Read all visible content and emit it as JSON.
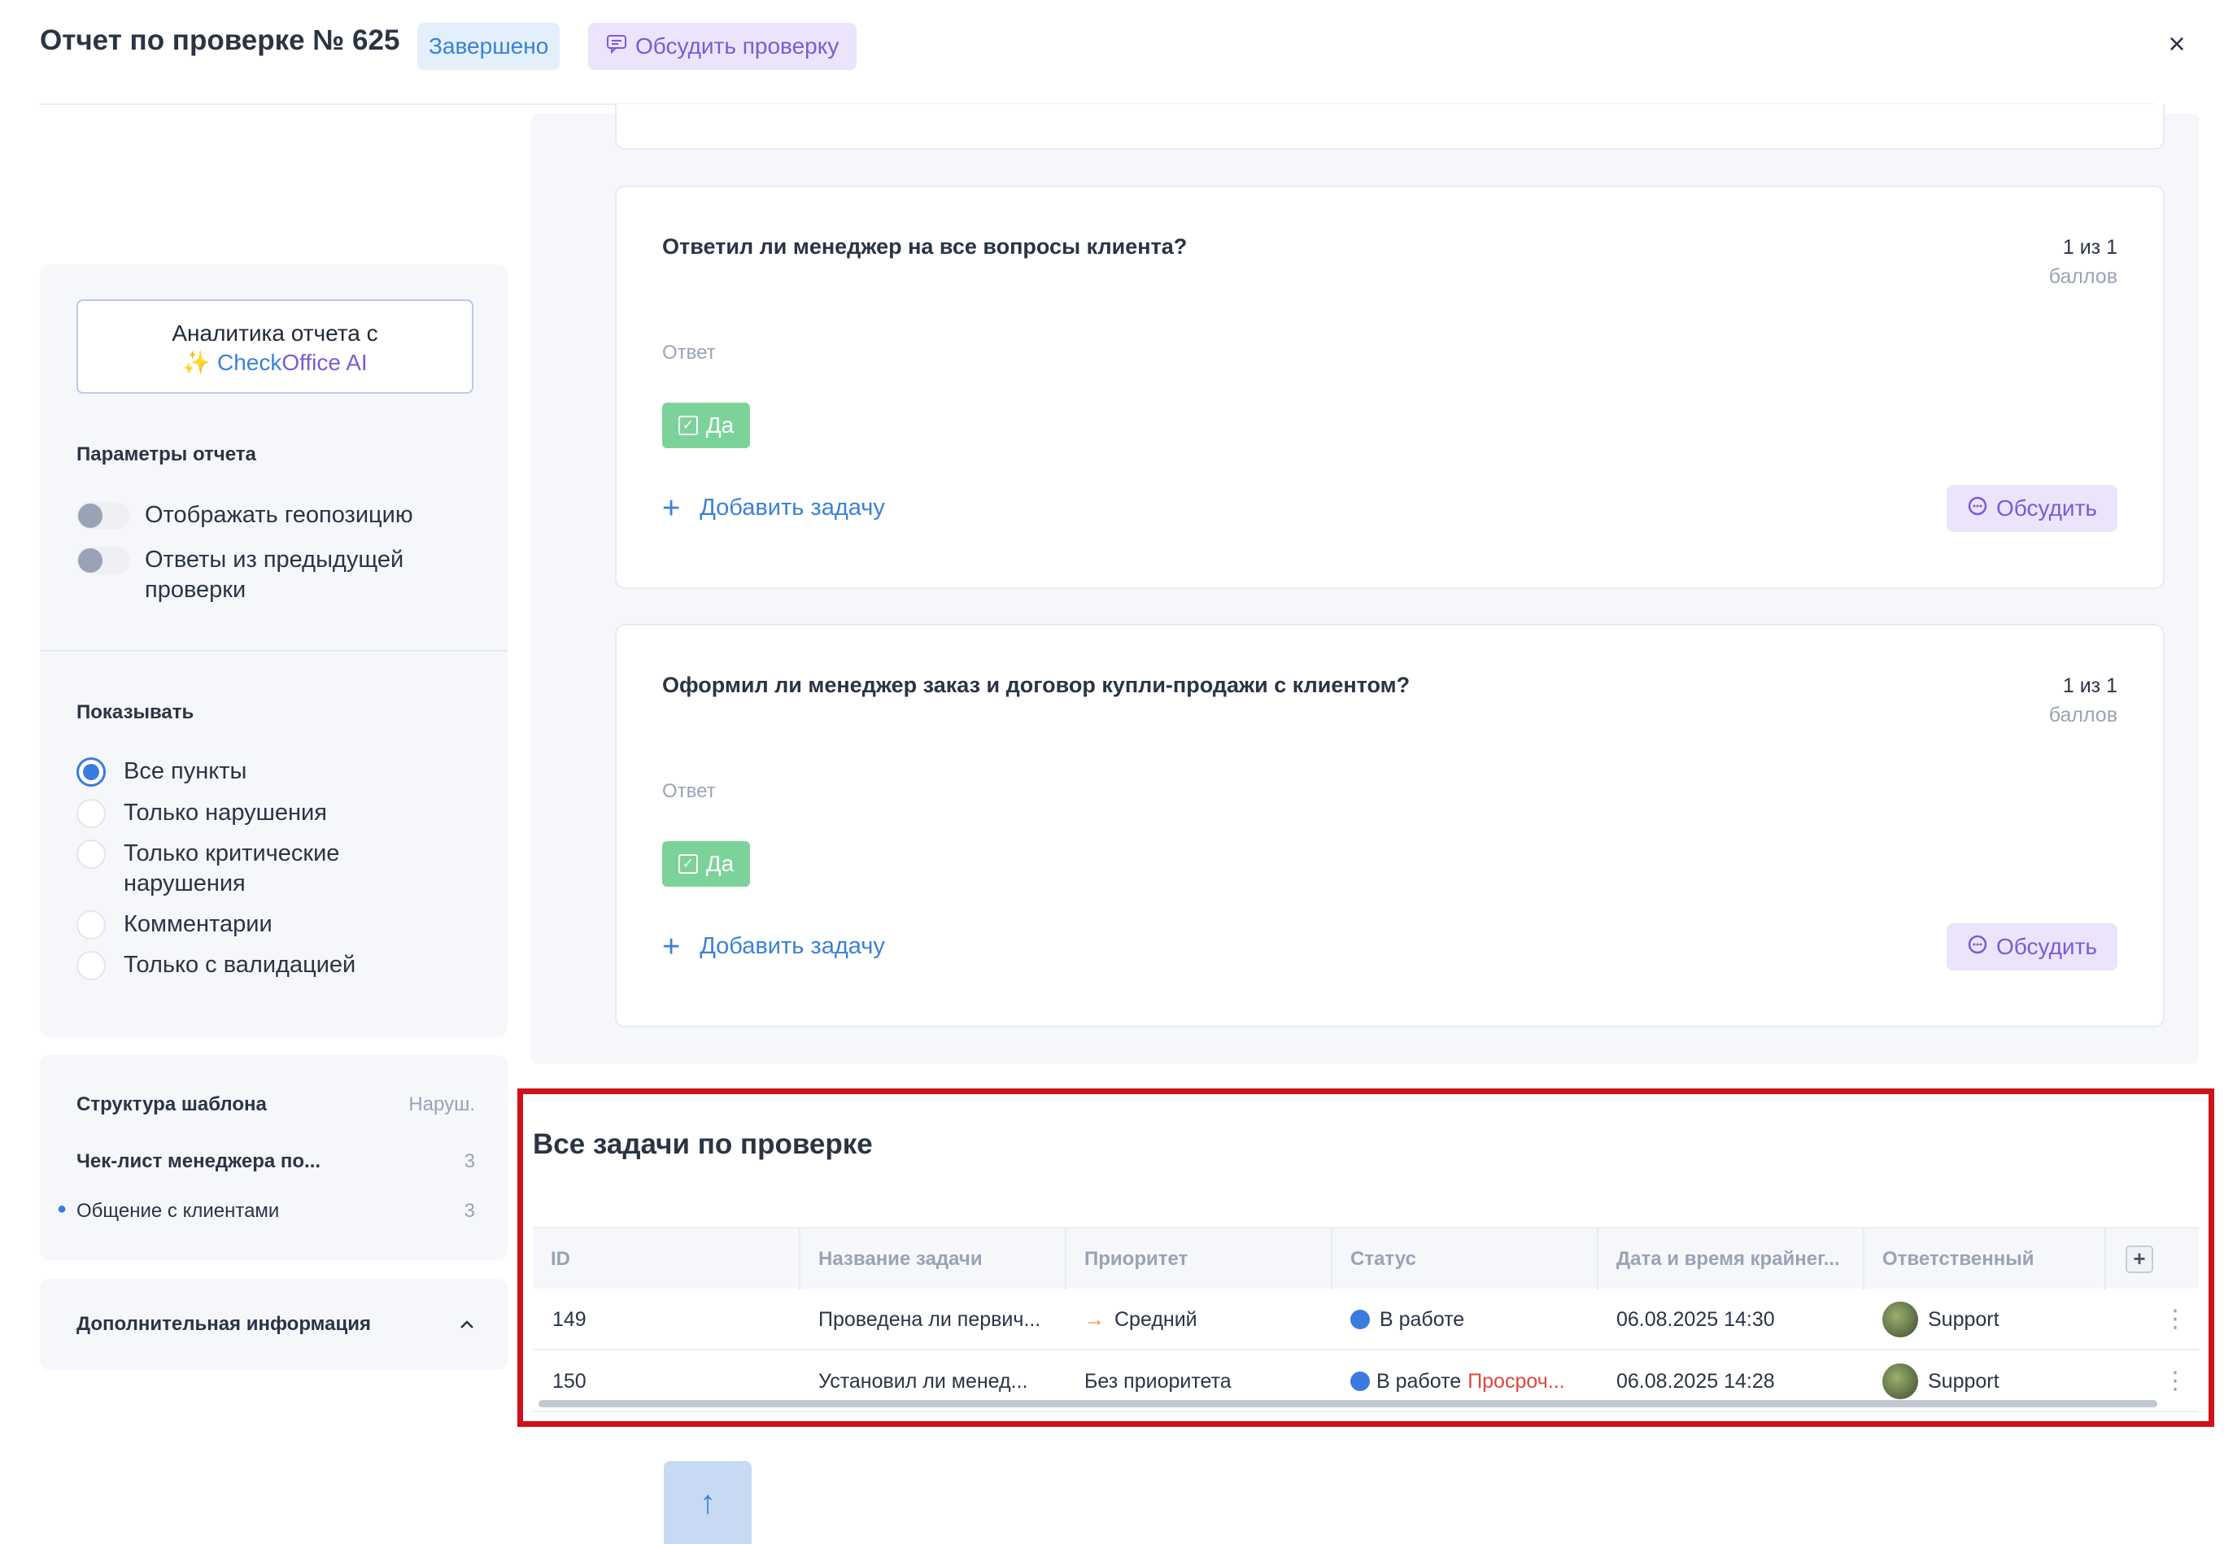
{
  "header": {
    "title": "Отчет по проверке № 625",
    "status_badge": "Завершено",
    "discuss_button": "Обсудить проверку",
    "close": "×"
  },
  "sidebar": {
    "ai_button_line1": "Аналитика отчета с",
    "ai_button_sparkle": "✨",
    "ai_button_brand1": "Check",
    "ai_button_brand2": "Office AI",
    "params_title": "Параметры отчета",
    "toggles": [
      {
        "label": "Отображать геопозицию",
        "on": false
      },
      {
        "label": "Ответы из предыдущей проверки",
        "on": false
      }
    ],
    "show_title": "Показывать",
    "radios": [
      {
        "label": "Все пункты",
        "checked": true
      },
      {
        "label": "Только нарушения",
        "checked": false
      },
      {
        "label": "Только критические нарушения",
        "checked": false
      },
      {
        "label": "Комментарии",
        "checked": false
      },
      {
        "label": "Только с валидацией",
        "checked": false
      }
    ],
    "structure_title": "Структура шаблона",
    "structure_col": "Наруш.",
    "structure_items": [
      {
        "label": "Чек-лист менеджера по...",
        "count": "3"
      },
      {
        "label": "Общение с клиентами",
        "count": "3"
      }
    ],
    "extra_title": "Дополнительная информация"
  },
  "questions": [
    {
      "title": "Ответил ли менеджер на все вопросы клиента?",
      "score": "1 из 1",
      "score_unit": "баллов",
      "answer_label": "Ответ",
      "answer": "Да",
      "add_task": "Добавить задачу",
      "discuss": "Обсудить"
    },
    {
      "title": "Оформил ли менеджер заказ и договор купли-продажи с клиентом?",
      "score": "1 из 1",
      "score_unit": "баллов",
      "answer_label": "Ответ",
      "answer": "Да",
      "add_task": "Добавить задачу",
      "discuss": "Обсудить"
    }
  ],
  "tasks": {
    "title": "Все задачи по проверке",
    "columns": [
      "ID",
      "Название задачи",
      "Приоритет",
      "Статус",
      "Дата и время крайнег...",
      "Ответственный"
    ],
    "add_column": "+",
    "rows": [
      {
        "id": "149",
        "name": "Проведена ли первич...",
        "priority": "Средний",
        "priority_icon": "→",
        "status": "В работе",
        "overdue": "",
        "deadline": "06.08.2025 14:30",
        "assignee": "Support"
      },
      {
        "id": "150",
        "name": "Установил ли менед...",
        "priority": "Без приоритета",
        "priority_icon": "",
        "status": "В работе",
        "overdue": "Просроч...",
        "deadline": "06.08.2025 14:28",
        "assignee": "Support"
      }
    ]
  },
  "scroll_top": "↑",
  "colors": {
    "accent_blue": "#3a82d6",
    "accent_purple": "#7b5bd6",
    "success_green": "#7cd39a",
    "danger_red": "#e0453a",
    "highlight_box": "#d0101a"
  }
}
